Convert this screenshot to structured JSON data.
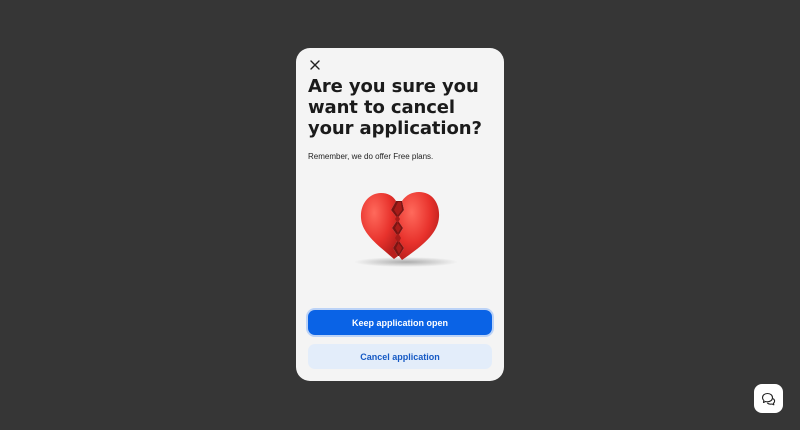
{
  "modal": {
    "close_icon": "close-icon",
    "title": "Are you sure you want to cancel your application?",
    "subtitle": "Remember, we do offer Free plans.",
    "illustration_icon": "broken-heart-icon",
    "primary_button": "Keep application open",
    "secondary_button": "Cancel application"
  },
  "chat_widget": {
    "icon": "chat-bubbles-icon"
  },
  "colors": {
    "backdrop": "#363636",
    "modal_bg": "#f4f4f4",
    "primary": "#0a63e6",
    "secondary_bg": "#e3edfa",
    "secondary_text": "#1559c4",
    "heart": "#e8322c"
  }
}
